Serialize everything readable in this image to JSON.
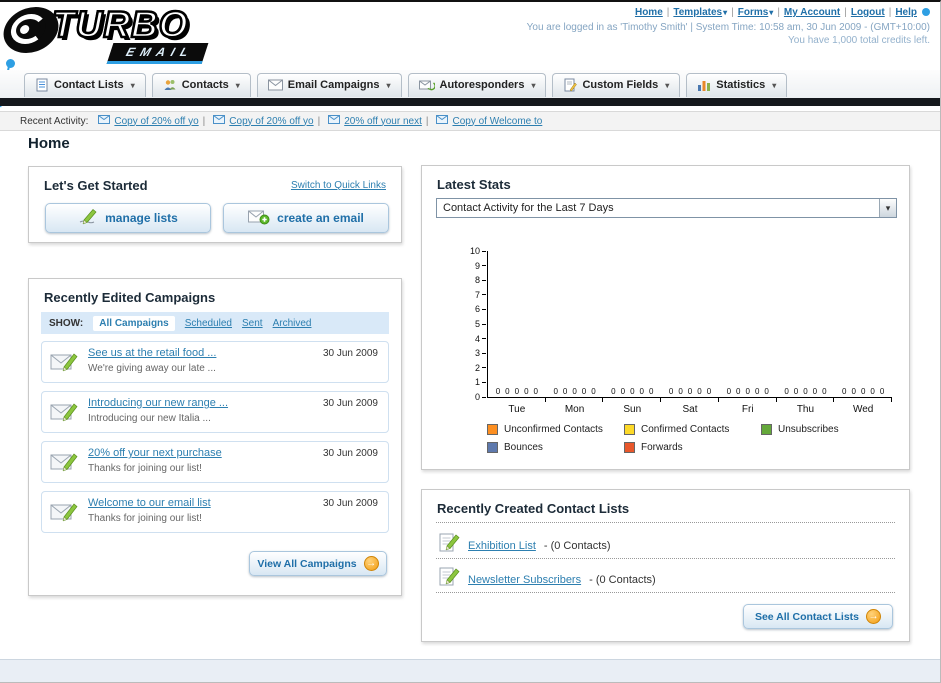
{
  "icons": {
    "caret_down": "▾",
    "separator": "|",
    "arrow_right": "→"
  },
  "header": {
    "logo_line1": "TURBO",
    "logo_line2": "EMAIL",
    "links": [
      {
        "label": "Home"
      },
      {
        "label": "Templates"
      },
      {
        "label": "Forms"
      },
      {
        "label": "My Account"
      },
      {
        "label": "Logout"
      },
      {
        "label": "Help"
      }
    ],
    "login_info": "You are logged in as 'Timothy Smith' | System Time: 10:58 am, 30 Jun 2009 - (GMT+10:00)",
    "credits_info": "You have 1,000 total credits left."
  },
  "nav": {
    "tabs": [
      {
        "label": "Contact Lists"
      },
      {
        "label": "Contacts"
      },
      {
        "label": "Email Campaigns"
      },
      {
        "label": "Autoresponders"
      },
      {
        "label": "Custom Fields"
      },
      {
        "label": "Statistics"
      }
    ]
  },
  "recent_activity": {
    "label": "Recent Activity:",
    "items": [
      "Copy of 20% off yo",
      "Copy of 20% off yo",
      "20% off your next",
      "Copy of Welcome to"
    ]
  },
  "page": {
    "title": "Home"
  },
  "get_started": {
    "title": "Let's Get Started",
    "switch_link": "Switch to Quick Links",
    "manage_lists_label": "manage lists",
    "create_email_label": "create an email"
  },
  "campaigns": {
    "title": "Recently Edited Campaigns",
    "show_label": "SHOW:",
    "filters": [
      "All Campaigns",
      "Scheduled",
      "Sent",
      "Archived"
    ],
    "active_filter": "All Campaigns",
    "rows": [
      {
        "title": "See us at the retail food ...",
        "subtitle": "We're giving away our late ...",
        "date": "30 Jun 2009"
      },
      {
        "title": "Introducing our new range ...",
        "subtitle": "Introducing our new Italia ...",
        "date": "30 Jun 2009"
      },
      {
        "title": "20% off your next purchase",
        "subtitle": "Thanks for joining our list!",
        "date": "30 Jun 2009"
      },
      {
        "title": "Welcome to our email list",
        "subtitle": "Thanks for joining our list!",
        "date": "30 Jun 2009"
      }
    ],
    "view_all_label": "View All Campaigns"
  },
  "stats": {
    "title": "Latest Stats",
    "dropdown_value": "Contact Activity for the Last 7 Days"
  },
  "chart_data": {
    "type": "bar",
    "title": "Contact Activity for the Last 7 Days",
    "categories": [
      "Tue",
      "Mon",
      "Sun",
      "Sat",
      "Fri",
      "Thu",
      "Wed"
    ],
    "series": [
      {
        "name": "Unconfirmed Contacts",
        "color": "#fd8f21",
        "values": [
          0,
          0,
          0,
          0,
          0,
          0,
          0
        ]
      },
      {
        "name": "Confirmed Contacts",
        "color": "#fdd928",
        "values": [
          0,
          0,
          0,
          0,
          0,
          0,
          0
        ]
      },
      {
        "name": "Unsubscribes",
        "color": "#64a83a",
        "values": [
          0,
          0,
          0,
          0,
          0,
          0,
          0
        ]
      },
      {
        "name": "Bounces",
        "color": "#5e79ad",
        "values": [
          0,
          0,
          0,
          0,
          0,
          0,
          0
        ]
      },
      {
        "name": "Forwards",
        "color": "#e8572b",
        "values": [
          0,
          0,
          0,
          0,
          0,
          0,
          0
        ]
      }
    ],
    "ylim": [
      0,
      10
    ],
    "ytick_step": 1,
    "grid": false,
    "legend_position": "bottom",
    "value_labels": true
  },
  "contact_lists": {
    "title": "Recently Created Contact Lists",
    "items": [
      {
        "name": "Exhibition List",
        "detail": "- (0 Contacts)"
      },
      {
        "name": "Newsletter Subscribers",
        "detail": "- (0 Contacts)"
      }
    ],
    "see_all_label": "See All Contact Lists"
  }
}
